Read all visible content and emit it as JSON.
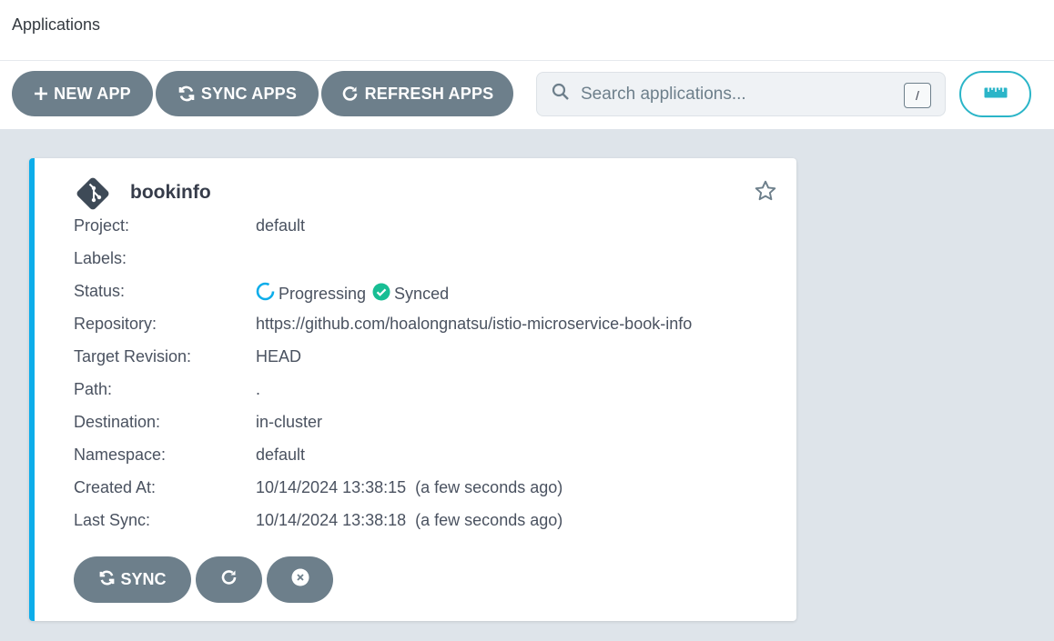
{
  "header": {
    "title": "Applications"
  },
  "toolbar": {
    "new_app": "NEW APP",
    "sync_apps": "SYNC APPS",
    "refresh_apps": "REFRESH APPS",
    "search_placeholder": "Search applications...",
    "search_shortcut": "/"
  },
  "app": {
    "name": "bookinfo",
    "fields": {
      "project_label": "Project:",
      "project": "default",
      "labels_label": "Labels:",
      "labels": "",
      "status_label": "Status:",
      "health": "Progressing",
      "sync": "Synced",
      "repo_label": "Repository:",
      "repo": "https://github.com/hoalongnatsu/istio-microservice-book-info",
      "revision_label": "Target Revision:",
      "revision": "HEAD",
      "path_label": "Path:",
      "path": ".",
      "dest_label": "Destination:",
      "dest": "in-cluster",
      "ns_label": "Namespace:",
      "ns": "default",
      "created_label": "Created At:",
      "created": "10/14/2024 13:38:15  (a few seconds ago)",
      "lastsync_label": "Last Sync:",
      "lastsync": "10/14/2024 13:38:18  (a few seconds ago)"
    },
    "actions": {
      "sync": "SYNC"
    }
  },
  "colors": {
    "button": "#6d7f8b",
    "accent": "#0dadea",
    "synced": "#18be94",
    "progressing": "#0dadea",
    "background": "#dee4ea"
  },
  "icons": {
    "new_app": "plus-icon",
    "sync_apps": "sync-icon",
    "refresh_apps": "redo-icon",
    "search": "search-icon",
    "view": "ruler-icon",
    "app_logo": "git-icon",
    "favorite": "star-icon",
    "health": "progressing-icon",
    "sync_status": "check-circle-icon",
    "card_sync": "sync-icon",
    "card_refresh": "redo-icon",
    "card_delete": "times-circle-icon"
  }
}
